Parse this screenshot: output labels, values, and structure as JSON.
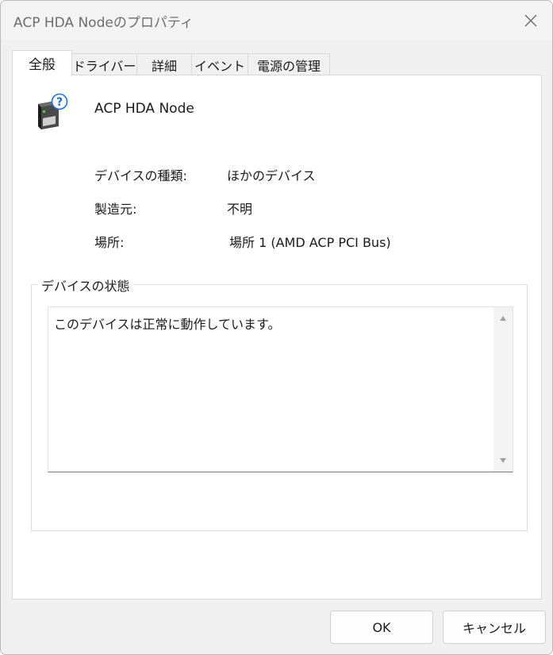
{
  "window": {
    "title": "ACP HDA Nodeのプロパティ"
  },
  "tabs": [
    {
      "label": "全般",
      "active": true
    },
    {
      "label": "ドライバー",
      "active": false
    },
    {
      "label": "詳細",
      "active": false
    },
    {
      "label": "イベント",
      "active": false
    },
    {
      "label": "電源の管理",
      "active": false
    }
  ],
  "device": {
    "name": "ACP HDA Node",
    "icon": "unknown-device-icon"
  },
  "properties": {
    "type_label": "デバイスの種類:",
    "type_value": "ほかのデバイス",
    "manufacturer_label": "製造元:",
    "manufacturer_value": "不明",
    "location_label": "場所:",
    "location_value": "場所 1 (AMD ACP PCI Bus)"
  },
  "status": {
    "group_label": "デバイスの状態",
    "text": "このデバイスは正常に動作しています。"
  },
  "buttons": {
    "ok": "OK",
    "cancel": "キャンセル"
  }
}
